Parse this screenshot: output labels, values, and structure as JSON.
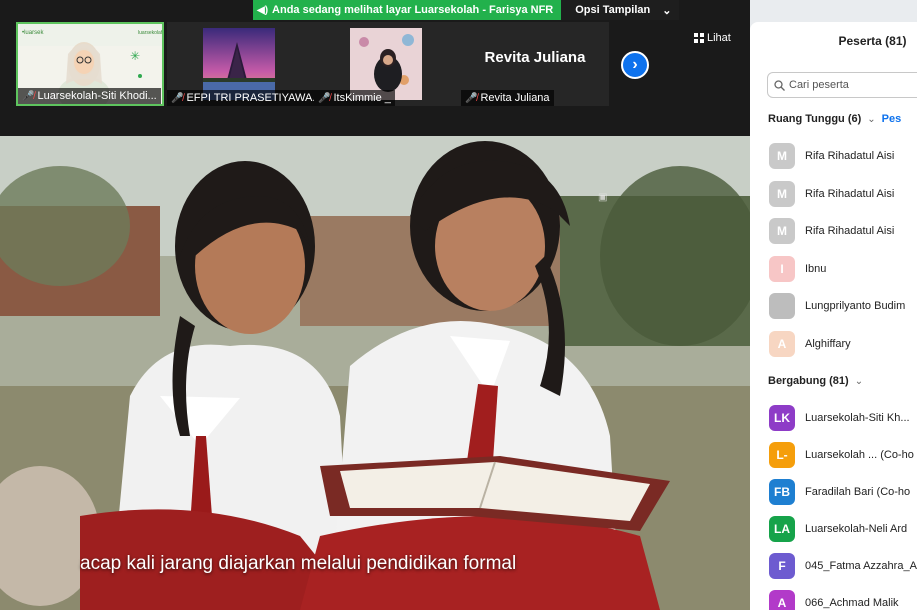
{
  "banner": {
    "text": "Anda sedang melihat layar Luarsekolah - Farisya NFR",
    "options_label": "Opsi Tampilan",
    "accent": "#22b14c"
  },
  "thumbnails": [
    {
      "name": "Luarsekolah-Siti Khodi..."
    },
    {
      "name": "EFPI TRI PRASETIYAWA..."
    },
    {
      "name": "ItsKimmie _"
    },
    {
      "name": "Revita Juliana",
      "big_label": "Revita Juliana"
    }
  ],
  "view_button": {
    "label": "Lihat",
    "icon": "grid-icon"
  },
  "video": {
    "caption": "acap kali jarang diajarkan melalui pendidikan formal"
  },
  "participants": {
    "title": "Peserta (81)",
    "search_placeholder": "Cari peserta",
    "waiting_label": "Ruang Tunggu (6)",
    "waiting_link": "Pes",
    "waiting": [
      {
        "initial": "M",
        "name": "Rifa Rihadatul Aisi",
        "color": "#c9c9c9"
      },
      {
        "initial": "M",
        "name": "Rifa Rihadatul Aisi",
        "color": "#c9c9c9"
      },
      {
        "initial": "M",
        "name": "Rifa Rihadatul Aisi",
        "color": "#c9c9c9"
      },
      {
        "initial": "I",
        "name": "Ibnu",
        "color": "#f7c6c6"
      },
      {
        "initial": "",
        "name": "Lungprilyanto Budim",
        "color": "#bdbdbd"
      },
      {
        "initial": "A",
        "name": "Alghiffary",
        "color": "#f7d6c2"
      }
    ],
    "joined_label": "Bergabung (81)",
    "joined": [
      {
        "initial": "LK",
        "name": "Luarsekolah-Siti Kh...",
        "color": "#8e3cc7"
      },
      {
        "initial": "L-",
        "name": "Luarsekolah ... (Co-ho",
        "color": "#f59e0b"
      },
      {
        "initial": "FB",
        "name": "Faradilah Bari (Co-ho",
        "color": "#1e7fd1"
      },
      {
        "initial": "LA",
        "name": "Luarsekolah-Neli Ard",
        "color": "#16a34a"
      },
      {
        "initial": "F",
        "name": "045_Fatma Azzahra_A",
        "color": "#6d5bd0"
      },
      {
        "initial": "A",
        "name": "066_Achmad Malik",
        "color": "#b23ac9"
      }
    ]
  }
}
